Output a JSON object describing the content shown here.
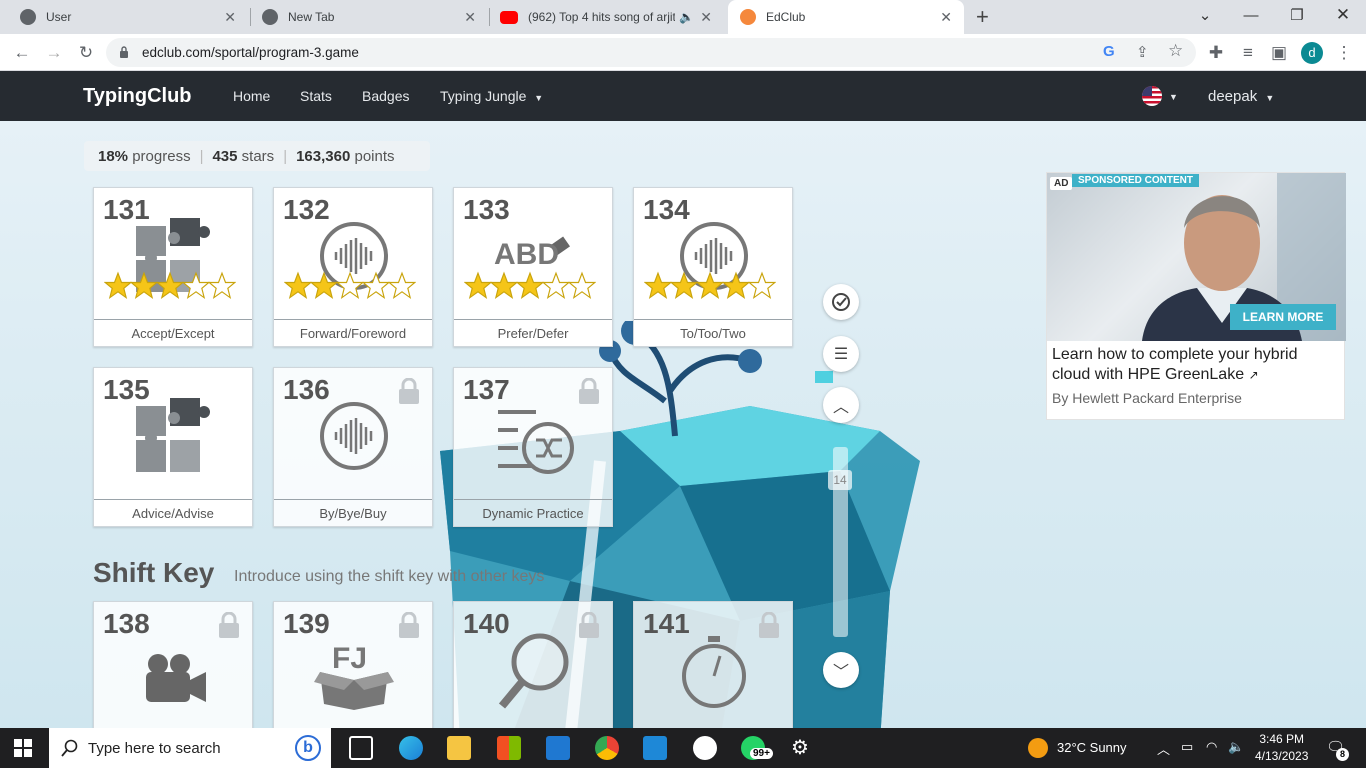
{
  "browser": {
    "tabs": [
      {
        "title": "User",
        "favicon": "globe-icon"
      },
      {
        "title": "New Tab",
        "favicon": "chrome-icon"
      },
      {
        "title": "(962) Top 4 hits song of arjit",
        "favicon": "youtube-icon"
      },
      {
        "title": "EdClub",
        "favicon": "edclub-icon"
      }
    ],
    "url": "edclub.com/sportal/program-3.game",
    "profile_initial": "d"
  },
  "nav": {
    "brand": "TypingClub",
    "links": [
      "Home",
      "Stats",
      "Badges",
      "Typing Jungle"
    ],
    "user": "deepak"
  },
  "stats": {
    "progress_value": "18%",
    "progress_label": "progress",
    "stars_value": "435",
    "stars_label": "stars",
    "points_value": "163,360",
    "points_label": "points"
  },
  "lessons": [
    {
      "number": "131",
      "label": "Accept/Except",
      "stars": 3,
      "icon": "puzzle-icon",
      "locked": false
    },
    {
      "number": "132",
      "label": "Forward/Foreword",
      "stars": 2,
      "icon": "sound-wave-icon",
      "locked": false
    },
    {
      "number": "133",
      "label": "Prefer/Defer",
      "stars": 3,
      "icon": "eraser-icon",
      "icon_text": "ABD",
      "locked": false
    },
    {
      "number": "134",
      "label": "To/Too/Two",
      "stars": 4,
      "icon": "sound-wave-icon",
      "locked": false
    },
    {
      "number": "135",
      "label": "Advice/Advise",
      "stars": 0,
      "icon": "puzzle-icon",
      "locked": false
    },
    {
      "number": "136",
      "label": "By/Bye/Buy",
      "stars": 0,
      "icon": "sound-wave-icon",
      "locked": true
    },
    {
      "number": "137",
      "label": "Dynamic Practice",
      "stars": 0,
      "icon": "shuffle-icon",
      "locked": true
    },
    {
      "number": "138",
      "label": "",
      "stars": 0,
      "icon": "video-camera-icon",
      "locked": true
    },
    {
      "number": "139",
      "label": "",
      "stars": 0,
      "icon": "box-icon",
      "icon_text": "FJ",
      "locked": true
    },
    {
      "number": "140",
      "label": "",
      "stars": 0,
      "icon": "magnifier-icon",
      "locked": true
    },
    {
      "number": "141",
      "label": "",
      "stars": 0,
      "icon": "stopwatch-icon",
      "locked": true
    }
  ],
  "section": {
    "title": "Shift Key",
    "description": "Introduce using the shift key with other keys"
  },
  "scroll": {
    "indicator": "14"
  },
  "ad": {
    "badge": "AD",
    "tag": "SPONSORED CONTENT",
    "cta": "LEARN MORE",
    "title": "Learn how to complete your hybrid cloud with HPE GreenLake",
    "byline": "By Hewlett Packard Enterprise"
  },
  "taskbar": {
    "search_placeholder": "Type here to search",
    "weather": "32°C  Sunny",
    "time": "3:46 PM",
    "date": "4/13/2023",
    "notifications": "8",
    "whatsapp_badge": "99+"
  },
  "colors": {
    "star": "#f5c518",
    "nav_bg": "#262b31",
    "ad_accent": "#3eb1c8"
  }
}
